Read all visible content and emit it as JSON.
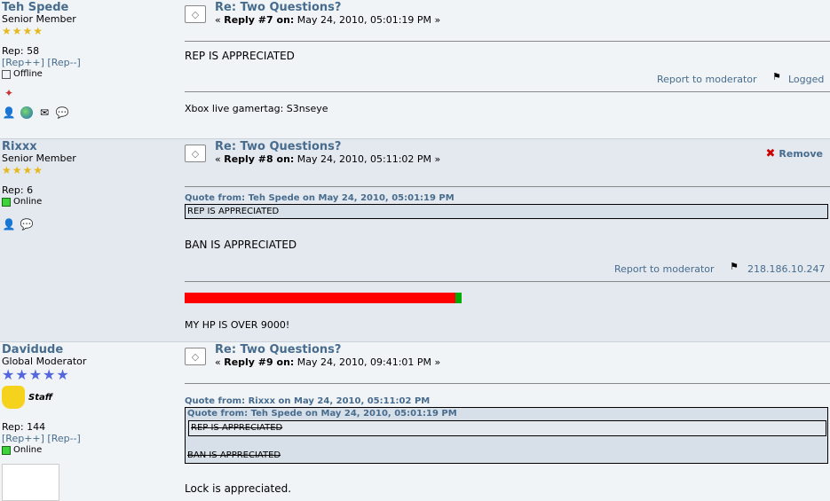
{
  "posts": [
    {
      "username": "Teh Spede",
      "title": "Senior Member",
      "stars": 4,
      "rep_label": "Rep: 58",
      "rep_plus": "[Rep++]",
      "rep_minus": "[Rep--]",
      "status": "Offline",
      "subject": "Re: Two Questions?",
      "reply_prefix": "«",
      "reply_num": "Reply #7 on:",
      "reply_date": "May 24, 2010, 05:01:19 PM »",
      "body": "REP IS APPRECIATED",
      "report": "Report to moderator",
      "logged": "Logged",
      "signature": "Xbox live gamertag: S3nseye"
    },
    {
      "username": "Rixxx",
      "title": "Senior Member",
      "stars": 4,
      "rep_label": "Rep: 6",
      "status": "Online",
      "subject": "Re: Two Questions?",
      "reply_prefix": "«",
      "reply_num": "Reply #8 on:",
      "reply_date": "May 24, 2010, 05:11:02 PM »",
      "remove": "Remove",
      "quote_header": "Quote from: Teh Spede on May 24, 2010, 05:01:19 PM",
      "quote_text": "REP IS APPRECIATED",
      "body": "BAN IS APPRECIATED",
      "report": "Report to moderator",
      "ip": "218.186.10.247",
      "hp_fraction": 0.977,
      "signature": "MY HP IS OVER 9000!"
    },
    {
      "username": "Davidude",
      "title": "Global Moderator",
      "stars": 5,
      "badge_label": "Staff",
      "rep_label": "Rep: 144",
      "rep_plus": "[Rep++]",
      "rep_minus": "[Rep--]",
      "status": "Online",
      "subject": "Re: Two Questions?",
      "reply_prefix": "«",
      "reply_num": "Reply #9 on:",
      "reply_date": "May 24, 2010, 09:41:01 PM »",
      "quote_header": "Quote from: Rixxx on May 24, 2010, 05:11:02 PM",
      "nested_quote_header": "Quote from: Teh Spede on May 24, 2010, 05:01:19 PM",
      "nested_quote_text": "REP IS APPRECIATED",
      "quote_text": "BAN IS APPRECIATED",
      "body": "Lock is appreciated."
    }
  ],
  "colors": {
    "link": "#476c8e",
    "hp_red": "#ff0000",
    "hp_green": "#00aa00"
  }
}
